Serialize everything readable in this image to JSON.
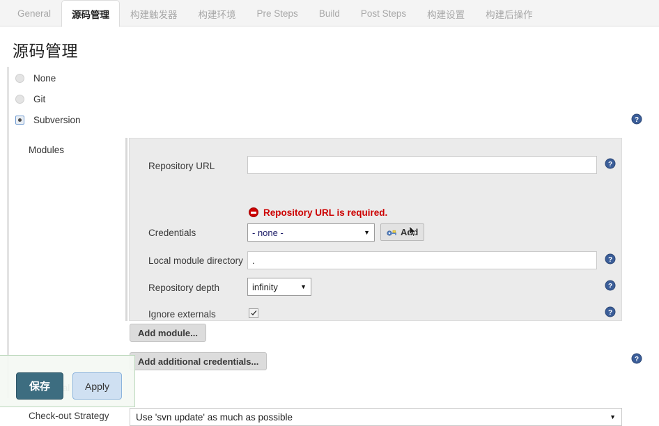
{
  "tabs": [
    {
      "label": "General",
      "active": false
    },
    {
      "label": "源码管理",
      "active": true
    },
    {
      "label": "构建触发器",
      "active": false
    },
    {
      "label": "构建环境",
      "active": false
    },
    {
      "label": "Pre Steps",
      "active": false
    },
    {
      "label": "Build",
      "active": false
    },
    {
      "label": "Post Steps",
      "active": false
    },
    {
      "label": "构建设置",
      "active": false
    },
    {
      "label": "构建后操作",
      "active": false
    }
  ],
  "page": {
    "title": "源码管理"
  },
  "scm_options": [
    {
      "label": "None",
      "selected": false
    },
    {
      "label": "Git",
      "selected": false
    },
    {
      "label": "Subversion",
      "selected": true
    }
  ],
  "modules": {
    "section_label": "Modules",
    "fields": {
      "repository_url": {
        "label": "Repository URL",
        "value": "",
        "error": "Repository URL is required."
      },
      "credentials": {
        "label": "Credentials",
        "value": "- none -",
        "add_label": "Add"
      },
      "local_module_directory": {
        "label": "Local module directory",
        "value": "."
      },
      "repository_depth": {
        "label": "Repository depth",
        "value": "infinity"
      },
      "ignore_externals": {
        "label": "Ignore externals",
        "checked": true
      }
    },
    "add_module_label": "Add module..."
  },
  "additional_credentials": {
    "label": "Additional Credentials",
    "button_label": "Add additional credentials..."
  },
  "checkout_strategy": {
    "label": "Check-out Strategy",
    "value": "Use 'svn update' as much as possible"
  },
  "savebar": {
    "save_label": "保存",
    "apply_label": "Apply"
  },
  "icons": {
    "help": "help-icon",
    "error": "error-icon",
    "key": "key-icon",
    "caret": "▼",
    "check": "check-icon"
  },
  "colors": {
    "error_red": "#cc0000",
    "help_blue": "#3b5e99",
    "save_teal": "#3d6d80",
    "apply_blue": "#cfe0f2",
    "panel_gray": "#ebebeb",
    "tab_inactive": "#a8a8a8"
  }
}
